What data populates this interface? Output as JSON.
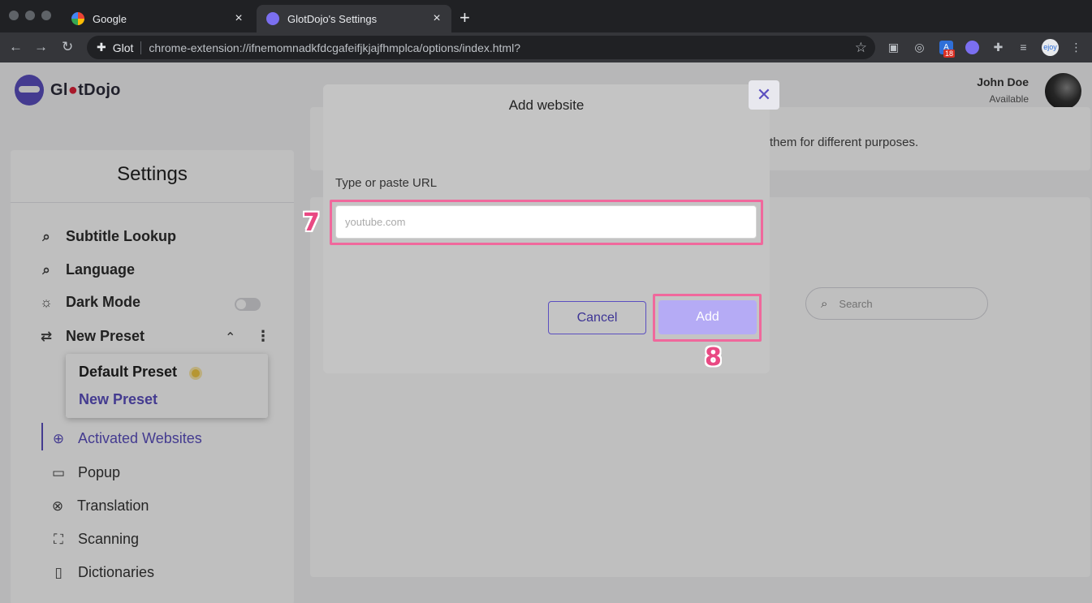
{
  "browser": {
    "tabs": [
      {
        "title": "Google",
        "active": false
      },
      {
        "title": "GlotDojo's Settings",
        "active": true
      }
    ],
    "omnibox": {
      "site_label": "Glot",
      "url": "chrome-extension://ifnemomnadkfdcgafeifjkjajfhmplca/options/index.html?"
    },
    "extensions": {
      "badge_count": "18",
      "ejoy_label": "ejoy"
    }
  },
  "app": {
    "logo": {
      "text_before": "Gl",
      "text_dot": "●",
      "text_after": "tDojo"
    },
    "user": {
      "name": "John Doe",
      "status": "Available"
    },
    "sidebar": {
      "title": "Settings",
      "items": [
        {
          "label": "Subtitle Lookup",
          "icon": "search-icon"
        },
        {
          "label": "Language",
          "icon": "search-icon"
        },
        {
          "label": "Dark Mode",
          "icon": "sunset-icon"
        },
        {
          "label": "New Preset",
          "icon": "swap-icon"
        }
      ],
      "preset_menu": {
        "default": "Default Preset",
        "new": "New Preset"
      },
      "sub_items": [
        {
          "label": "Activated Websites",
          "icon": "globe-icon",
          "active": true
        },
        {
          "label": "Popup",
          "icon": "chat-bubble-icon"
        },
        {
          "label": "Translation",
          "icon": "translate-icon"
        },
        {
          "label": "Scanning",
          "icon": "scan-icon"
        },
        {
          "label": "Dictionaries",
          "icon": "book-icon"
        }
      ]
    },
    "card1_text": "them for different purposes.",
    "search_placeholder": "Search"
  },
  "modal": {
    "title": "Add website",
    "field_label": "Type or paste URL",
    "input_placeholder": "youtube.com",
    "input_value": "",
    "cancel_label": "Cancel",
    "add_label": "Add",
    "close_glyph": "✕"
  },
  "annotations": {
    "step_input": "7",
    "step_add": "8"
  },
  "colors": {
    "accent": "#5b4fc0",
    "add_button": "#b5abf5",
    "highlight": "#f0689c"
  }
}
